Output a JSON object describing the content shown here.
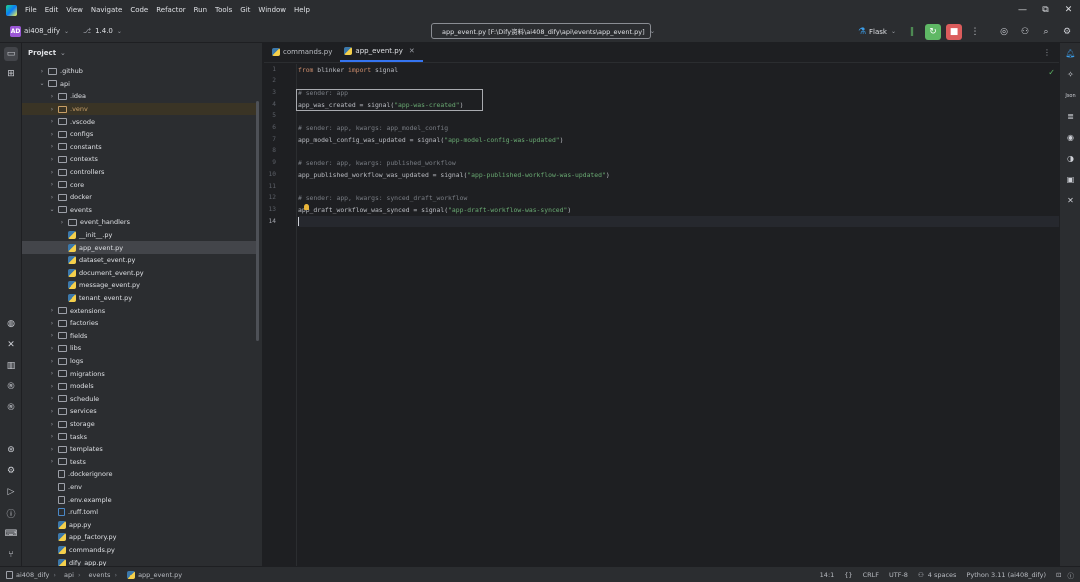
{
  "menubar": {
    "items": [
      "File",
      "Edit",
      "View",
      "Navigate",
      "Code",
      "Refactor",
      "Run",
      "Tools",
      "Git",
      "Window",
      "Help"
    ]
  },
  "window_controls": {
    "minimize": "—",
    "restore": "⧉",
    "close": "✕"
  },
  "toolbar": {
    "project_badge": "AD",
    "project_name": "ai408_dify",
    "branch": "1.4.0",
    "run_config": "app_event.py [F:\\Dify资料\\ai408_dify\\api\\events\\app_event.py]",
    "run_target": "Flask"
  },
  "project_panel": {
    "title": "Project",
    "tree": [
      {
        "label": ".github",
        "type": "folder",
        "depth": 1,
        "arrow": "›"
      },
      {
        "label": "api",
        "type": "folder",
        "depth": 1,
        "arrow": "⌄"
      },
      {
        "label": ".idea",
        "type": "folder",
        "depth": 2,
        "arrow": "›"
      },
      {
        "label": ".venv",
        "type": "folder-excluded",
        "depth": 2,
        "arrow": "›"
      },
      {
        "label": ".vscode",
        "type": "folder",
        "depth": 2,
        "arrow": "›"
      },
      {
        "label": "configs",
        "type": "folder",
        "depth": 2,
        "arrow": "›"
      },
      {
        "label": "constants",
        "type": "folder",
        "depth": 2,
        "arrow": "›"
      },
      {
        "label": "contexts",
        "type": "folder",
        "depth": 2,
        "arrow": "›"
      },
      {
        "label": "controllers",
        "type": "folder",
        "depth": 2,
        "arrow": "›"
      },
      {
        "label": "core",
        "type": "folder",
        "depth": 2,
        "arrow": "›"
      },
      {
        "label": "docker",
        "type": "folder",
        "depth": 2,
        "arrow": "›"
      },
      {
        "label": "events",
        "type": "folder",
        "depth": 2,
        "arrow": "⌄"
      },
      {
        "label": "event_handlers",
        "type": "folder",
        "depth": 3,
        "arrow": "›"
      },
      {
        "label": "__init__.py",
        "type": "py",
        "depth": 3,
        "arrow": ""
      },
      {
        "label": "app_event.py",
        "type": "py",
        "depth": 3,
        "arrow": ""
      },
      {
        "label": "dataset_event.py",
        "type": "py",
        "depth": 3,
        "arrow": ""
      },
      {
        "label": "document_event.py",
        "type": "py",
        "depth": 3,
        "arrow": ""
      },
      {
        "label": "message_event.py",
        "type": "py",
        "depth": 3,
        "arrow": ""
      },
      {
        "label": "tenant_event.py",
        "type": "py",
        "depth": 3,
        "arrow": ""
      },
      {
        "label": "extensions",
        "type": "folder",
        "depth": 2,
        "arrow": "›"
      },
      {
        "label": "factories",
        "type": "folder",
        "depth": 2,
        "arrow": "›"
      },
      {
        "label": "fields",
        "type": "folder",
        "depth": 2,
        "arrow": "›"
      },
      {
        "label": "libs",
        "type": "folder",
        "depth": 2,
        "arrow": "›"
      },
      {
        "label": "logs",
        "type": "folder",
        "depth": 2,
        "arrow": "›"
      },
      {
        "label": "migrations",
        "type": "folder",
        "depth": 2,
        "arrow": "›"
      },
      {
        "label": "models",
        "type": "folder",
        "depth": 2,
        "arrow": "›"
      },
      {
        "label": "schedule",
        "type": "folder",
        "depth": 2,
        "arrow": "›"
      },
      {
        "label": "services",
        "type": "folder",
        "depth": 2,
        "arrow": "›"
      },
      {
        "label": "storage",
        "type": "folder",
        "depth": 2,
        "arrow": "›"
      },
      {
        "label": "tasks",
        "type": "folder",
        "depth": 2,
        "arrow": "›"
      },
      {
        "label": "templates",
        "type": "folder",
        "depth": 2,
        "arrow": "›"
      },
      {
        "label": "tests",
        "type": "folder",
        "depth": 2,
        "arrow": "›"
      },
      {
        "label": ".dockerignore",
        "type": "file",
        "depth": 2,
        "arrow": ""
      },
      {
        "label": ".env",
        "type": "file",
        "depth": 2,
        "arrow": ""
      },
      {
        "label": ".env.example",
        "type": "file",
        "depth": 2,
        "arrow": ""
      },
      {
        "label": ".ruff.toml",
        "type": "file-blue",
        "depth": 2,
        "arrow": ""
      },
      {
        "label": "app.py",
        "type": "py",
        "depth": 2,
        "arrow": ""
      },
      {
        "label": "app_factory.py",
        "type": "py",
        "depth": 2,
        "arrow": ""
      },
      {
        "label": "commands.py",
        "type": "py",
        "depth": 2,
        "arrow": ""
      },
      {
        "label": "dify_app.py",
        "type": "py",
        "depth": 2,
        "arrow": ""
      }
    ],
    "selected": "app_event.py",
    "highlighted": ".venv"
  },
  "editor": {
    "tabs": [
      {
        "label": "commands.py",
        "active": false
      },
      {
        "label": "app_event.py",
        "active": true
      }
    ],
    "current_line": 14,
    "lines": [
      [
        {
          "t": "from",
          "c": "kw"
        },
        {
          "t": " blinker ",
          "c": ""
        },
        {
          "t": "import",
          "c": "kw"
        },
        {
          "t": " signal",
          "c": ""
        }
      ],
      [],
      [
        {
          "t": "# sender: app",
          "c": "cm"
        }
      ],
      [
        {
          "t": "app_was_created = signal(",
          "c": ""
        },
        {
          "t": "\"app-was-created\"",
          "c": "str"
        },
        {
          "t": ")",
          "c": ""
        }
      ],
      [],
      [
        {
          "t": "# sender: app, kwargs: app_model_config",
          "c": "cm"
        }
      ],
      [
        {
          "t": "app_model_config_was_updated = signal(",
          "c": ""
        },
        {
          "t": "\"app-model-config-was-updated\"",
          "c": "str"
        },
        {
          "t": ")",
          "c": ""
        }
      ],
      [],
      [
        {
          "t": "# sender: app, kwargs: published_workflow",
          "c": "cm"
        }
      ],
      [
        {
          "t": "app_published_workflow_was_updated = signal(",
          "c": ""
        },
        {
          "t": "\"app-published-workflow-was-updated\"",
          "c": "str"
        },
        {
          "t": ")",
          "c": ""
        }
      ],
      [],
      [
        {
          "t": "# sender: app, kwargs: synced_draft_workflow",
          "c": "cm"
        }
      ],
      [
        {
          "t": "app_draft_workflow_was_synced = signal(",
          "c": ""
        },
        {
          "t": "\"app-draft-workflow-was-synced\"",
          "c": "str"
        },
        {
          "t": ")",
          "c": ""
        }
      ],
      []
    ]
  },
  "statusbar": {
    "breadcrumbs": [
      "ai408_dify",
      "api",
      "events",
      "app_event.py"
    ],
    "position": "14:1",
    "line_ending": "CRLF",
    "encoding": "UTF-8",
    "indent": "4 spaces",
    "interpreter": "Python 3.11 (ai408_dify)"
  }
}
